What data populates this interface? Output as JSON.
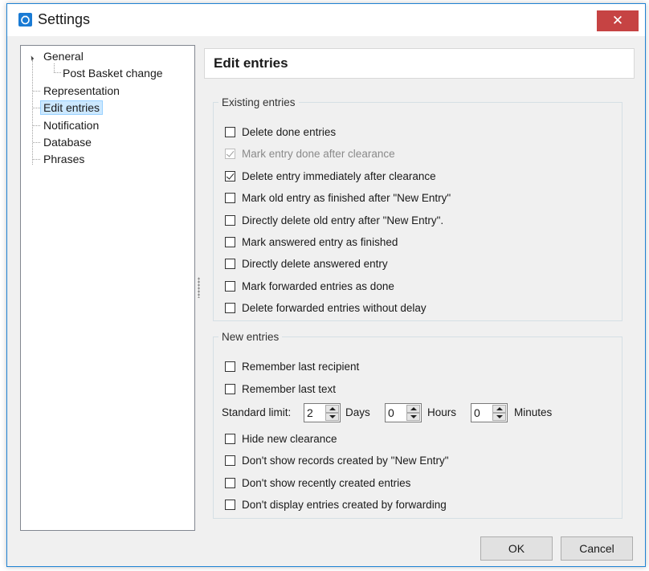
{
  "window": {
    "title": "Settings"
  },
  "titlebar": {
    "close_glyph": "✕"
  },
  "tree": {
    "items": [
      {
        "label": "General"
      },
      {
        "label": "Post Basket change"
      },
      {
        "label": "Representation"
      },
      {
        "label": "Edit entries"
      },
      {
        "label": "Notification"
      },
      {
        "label": "Database"
      },
      {
        "label": "Phrases"
      }
    ],
    "selected": "Edit entries"
  },
  "content": {
    "title": "Edit entries",
    "existing": {
      "legend": "Existing entries",
      "options": [
        {
          "label": "Delete done entries",
          "checked": false,
          "disabled": false
        },
        {
          "label": "Mark entry done after clearance",
          "checked": true,
          "disabled": true
        },
        {
          "label": "Delete entry immediately after clearance",
          "checked": true,
          "disabled": false
        },
        {
          "label": "Mark old entry as finished after \"New Entry\"",
          "checked": false,
          "disabled": false
        },
        {
          "label": "Directly delete old entry after \"New Entry\".",
          "checked": false,
          "disabled": false
        },
        {
          "label": "Mark answered entry as finished",
          "checked": false,
          "disabled": false
        },
        {
          "label": "Directly delete answered entry",
          "checked": false,
          "disabled": false
        },
        {
          "label": "Mark forwarded entries as done",
          "checked": false,
          "disabled": false
        },
        {
          "label": "Delete forwarded entries without delay",
          "checked": false,
          "disabled": false
        }
      ]
    },
    "new": {
      "legend": "New entries",
      "options_top": [
        {
          "label": "Remember last recipient",
          "checked": false
        },
        {
          "label": "Remember last text",
          "checked": false
        }
      ],
      "limit": {
        "label": "Standard limit:",
        "days_value": "2",
        "days_label": "Days",
        "hours_value": "0",
        "hours_label": "Hours",
        "minutes_value": "0",
        "minutes_label": "Minutes"
      },
      "options_bottom": [
        {
          "label": "Hide new clearance",
          "checked": false
        },
        {
          "label": "Don't show records created by \"New Entry\"",
          "checked": false
        },
        {
          "label": "Don't show recently created entries",
          "checked": false
        },
        {
          "label": "Don't display entries created by forwarding",
          "checked": false
        }
      ]
    }
  },
  "footer": {
    "ok_label": "OK",
    "cancel_label": "Cancel"
  }
}
